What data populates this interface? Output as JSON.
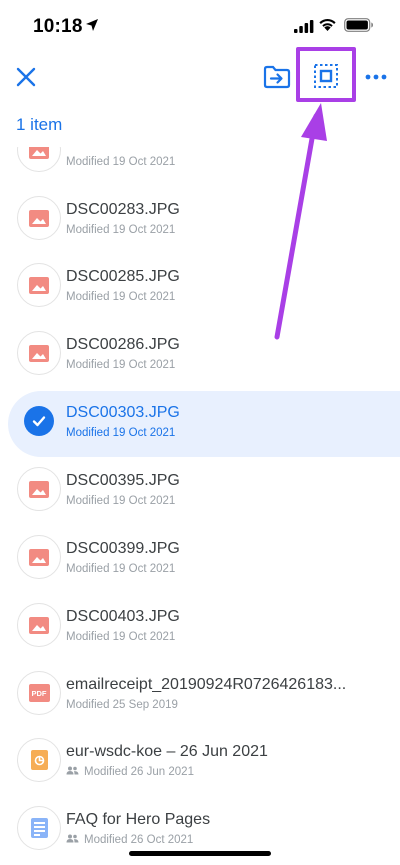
{
  "status": {
    "time": "10:18"
  },
  "selection": {
    "count_label": "1 item"
  },
  "colors": {
    "accent": "#1a73e8",
    "annotation": "#a93fe6",
    "selected_bg": "#e8f0fe",
    "thumb_red": "#f28b82"
  },
  "files": [
    {
      "name": "",
      "modified": "Modified 19 Oct 2021",
      "icon": "image-icon"
    },
    {
      "name": "DSC00283.JPG",
      "modified": "Modified 19 Oct 2021",
      "icon": "image-icon"
    },
    {
      "name": "DSC00285.JPG",
      "modified": "Modified 19 Oct 2021",
      "icon": "image-icon"
    },
    {
      "name": "DSC00286.JPG",
      "modified": "Modified 19 Oct 2021",
      "icon": "image-icon"
    },
    {
      "name": "DSC00303.JPG",
      "modified": "Modified 19 Oct 2021",
      "icon": "check-circle-icon",
      "selected": true
    },
    {
      "name": "DSC00395.JPG",
      "modified": "Modified 19 Oct 2021",
      "icon": "image-icon"
    },
    {
      "name": "DSC00399.JPG",
      "modified": "Modified 19 Oct 2021",
      "icon": "image-icon"
    },
    {
      "name": "DSC00403.JPG",
      "modified": "Modified 19 Oct 2021",
      "icon": "image-icon"
    },
    {
      "name": "emailreceipt_20190924R0726426183...",
      "modified": "Modified 25 Sep 2019",
      "icon": "pdf-icon"
    },
    {
      "name": "eur-wsdc-koe – 26 Jun 2021",
      "modified": "Modified 26 Jun 2021",
      "icon": "slides-icon",
      "shared": true
    },
    {
      "name": "FAQ for Hero Pages",
      "modified": "Modified 26 Oct 2021",
      "icon": "docs-icon",
      "shared": true
    }
  ]
}
